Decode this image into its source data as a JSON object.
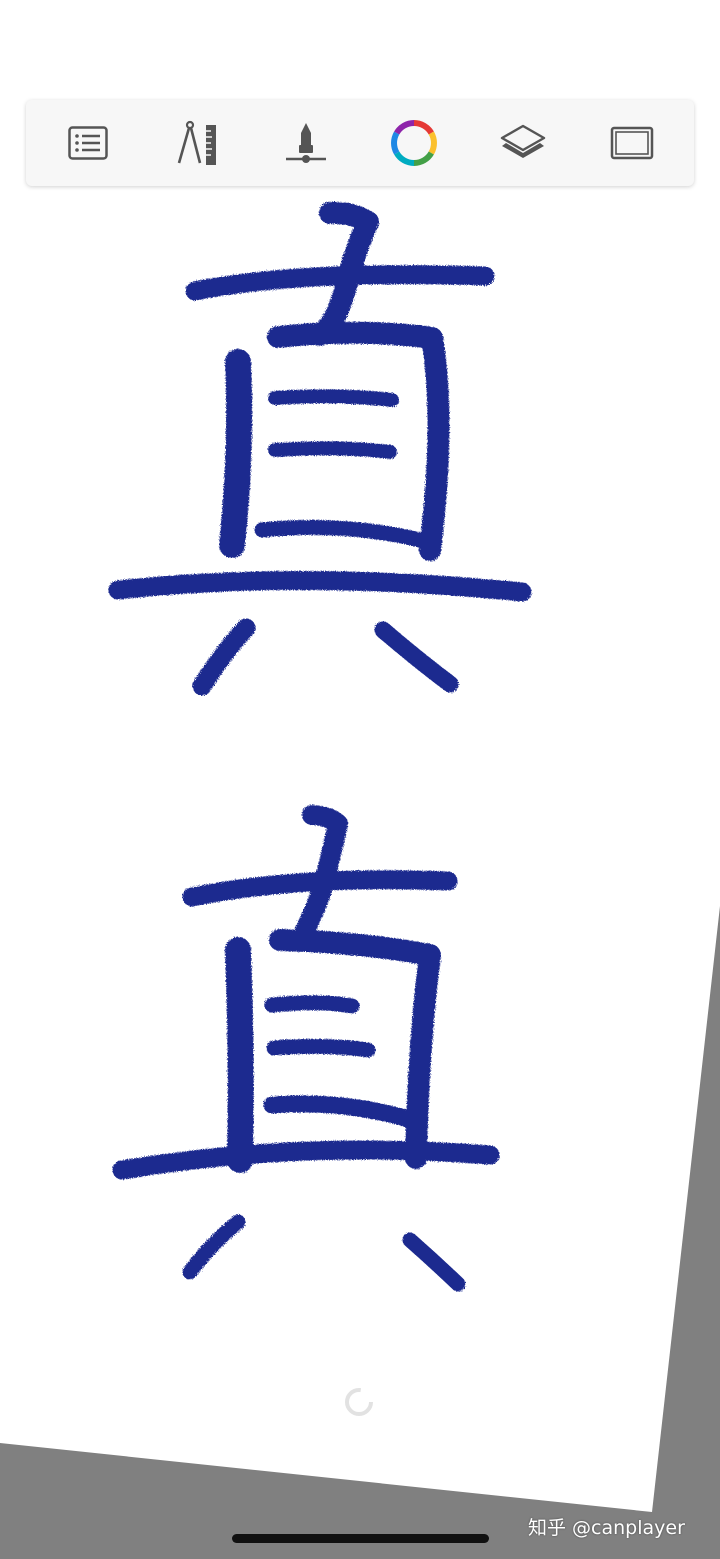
{
  "colors": {
    "ink": "#1b2a8f",
    "paper": "#ffffff",
    "background": "#808080",
    "toolbar_bg": "#f7f7f7",
    "icon_gray": "#555555",
    "spinner": "#e2e2e2"
  },
  "toolbar": {
    "tools": [
      {
        "name": "menu-list-icon"
      },
      {
        "name": "guides-compass-ruler-icon"
      },
      {
        "name": "brush-tool-icon"
      },
      {
        "name": "color-wheel-icon"
      },
      {
        "name": "layers-icon"
      },
      {
        "name": "fullscreen-frame-icon"
      }
    ]
  },
  "canvas": {
    "characters": [
      {
        "glyph": "真",
        "label": "handwritten-character-upper"
      },
      {
        "glyph": "真",
        "label": "handwritten-character-lower"
      }
    ]
  },
  "watermark": {
    "text": "知乎 @canplayer"
  }
}
